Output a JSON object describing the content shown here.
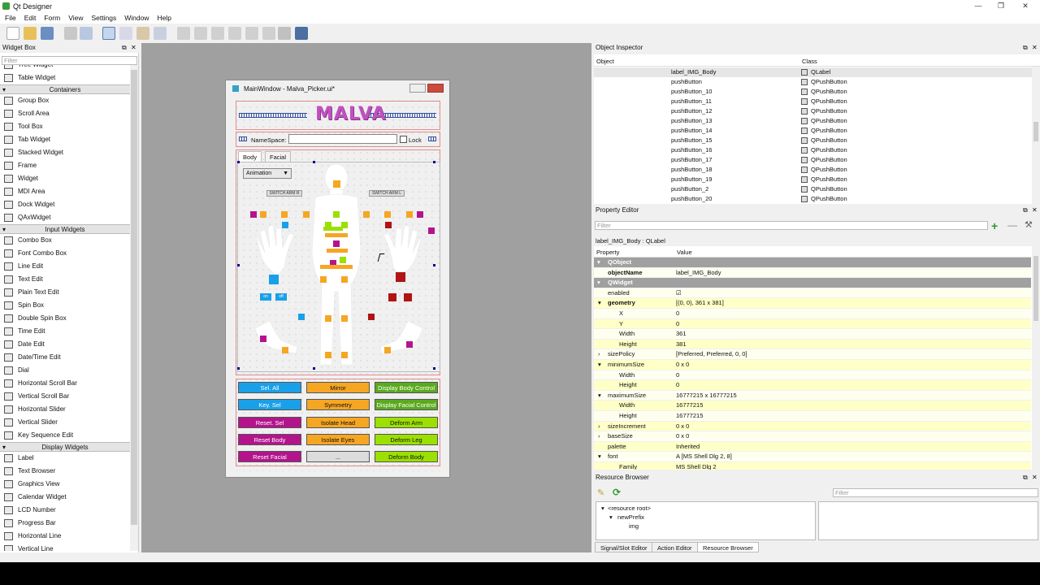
{
  "app": {
    "title": "Qt Designer"
  },
  "menu": [
    "File",
    "Edit",
    "Form",
    "View",
    "Settings",
    "Window",
    "Help"
  ],
  "widget_box": {
    "title": "Widget Box",
    "filter_placeholder": "Filter",
    "items": [
      {
        "t": "item",
        "label": "Tree Widget"
      },
      {
        "t": "item",
        "label": "Table Widget"
      },
      {
        "t": "cat",
        "label": "Containers"
      },
      {
        "t": "item",
        "label": "Group Box"
      },
      {
        "t": "item",
        "label": "Scroll Area"
      },
      {
        "t": "item",
        "label": "Tool Box"
      },
      {
        "t": "item",
        "label": "Tab Widget"
      },
      {
        "t": "item",
        "label": "Stacked Widget"
      },
      {
        "t": "item",
        "label": "Frame"
      },
      {
        "t": "item",
        "label": "Widget"
      },
      {
        "t": "item",
        "label": "MDI Area"
      },
      {
        "t": "item",
        "label": "Dock Widget"
      },
      {
        "t": "item",
        "label": "QAxWidget"
      },
      {
        "t": "cat",
        "label": "Input Widgets"
      },
      {
        "t": "item",
        "label": "Combo Box"
      },
      {
        "t": "item",
        "label": "Font Combo Box"
      },
      {
        "t": "item",
        "label": "Line Edit"
      },
      {
        "t": "item",
        "label": "Text Edit"
      },
      {
        "t": "item",
        "label": "Plain Text Edit"
      },
      {
        "t": "item",
        "label": "Spin Box"
      },
      {
        "t": "item",
        "label": "Double Spin Box"
      },
      {
        "t": "item",
        "label": "Time Edit"
      },
      {
        "t": "item",
        "label": "Date Edit"
      },
      {
        "t": "item",
        "label": "Date/Time Edit"
      },
      {
        "t": "item",
        "label": "Dial"
      },
      {
        "t": "item",
        "label": "Horizontal Scroll Bar"
      },
      {
        "t": "item",
        "label": "Vertical Scroll Bar"
      },
      {
        "t": "item",
        "label": "Horizontal Slider"
      },
      {
        "t": "item",
        "label": "Vertical Slider"
      },
      {
        "t": "item",
        "label": "Key Sequence Edit"
      },
      {
        "t": "cat",
        "label": "Display Widgets"
      },
      {
        "t": "item",
        "label": "Label"
      },
      {
        "t": "item",
        "label": "Text Browser"
      },
      {
        "t": "item",
        "label": "Graphics View"
      },
      {
        "t": "item",
        "label": "Calendar Widget"
      },
      {
        "t": "item",
        "label": "LCD Number"
      },
      {
        "t": "item",
        "label": "Progress Bar"
      },
      {
        "t": "item",
        "label": "Horizontal Line"
      },
      {
        "t": "item",
        "label": "Vertical Line"
      }
    ]
  },
  "form": {
    "title": "MainWindow - Malva_Picker.ui*",
    "logo": "MALVA",
    "namespace_label": "NameSpace:",
    "lock_label": "Lock",
    "tabs": [
      "Body",
      "Facial"
    ],
    "combo_value": "Animation",
    "switch_r": "SWITCH ARM R",
    "switch_l": "SWITCH ARM L",
    "small_btn_1": "on",
    "small_btn_2": "off",
    "grid": [
      [
        {
          "label": "Sel. All",
          "color": "#1aa0e8"
        },
        {
          "label": "Mirror",
          "color": "#f5a623"
        },
        {
          "label": "Display Body Control",
          "color": "#5aaa1e"
        }
      ],
      [
        {
          "label": "Key. Sel",
          "color": "#1aa0e8"
        },
        {
          "label": "Symmetry",
          "color": "#f5a623"
        },
        {
          "label": "Display Facial Control",
          "color": "#5aaa1e"
        }
      ],
      [
        {
          "label": "Reset. Sel",
          "color": "#b3148c"
        },
        {
          "label": "Isolate Head",
          "color": "#f5a623"
        },
        {
          "label": "Deform Arm",
          "color": "#9be000"
        }
      ],
      [
        {
          "label": "Reset Body",
          "color": "#b3148c"
        },
        {
          "label": "Isolate Eyes",
          "color": "#f5a623"
        },
        {
          "label": "Deform Leg",
          "color": "#9be000"
        }
      ],
      [
        {
          "label": "Reset Facial",
          "color": "#b3148c"
        },
        {
          "label": "...",
          "color": "#dcdcdc"
        },
        {
          "label": "Deform Body",
          "color": "#9be000"
        }
      ]
    ]
  },
  "object_inspector": {
    "title": "Object Inspector",
    "col_object": "Object",
    "col_class": "Class",
    "rows": [
      {
        "name": "label_IMG_Body",
        "cls": "QLabel"
      },
      {
        "name": "pushButton",
        "cls": "QPushButton"
      },
      {
        "name": "pushButton_10",
        "cls": "QPushButton"
      },
      {
        "name": "pushButton_11",
        "cls": "QPushButton"
      },
      {
        "name": "pushButton_12",
        "cls": "QPushButton"
      },
      {
        "name": "pushButton_13",
        "cls": "QPushButton"
      },
      {
        "name": "pushButton_14",
        "cls": "QPushButton"
      },
      {
        "name": "pushButton_15",
        "cls": "QPushButton"
      },
      {
        "name": "pushButton_16",
        "cls": "QPushButton"
      },
      {
        "name": "pushButton_17",
        "cls": "QPushButton"
      },
      {
        "name": "pushButton_18",
        "cls": "QPushButton"
      },
      {
        "name": "pushButton_19",
        "cls": "QPushButton"
      },
      {
        "name": "pushButton_2",
        "cls": "QPushButton"
      },
      {
        "name": "pushButton_20",
        "cls": "QPushButton"
      }
    ]
  },
  "property_editor": {
    "title": "Property Editor",
    "filter_placeholder": "Filter",
    "context": "label_IMG_Body : QLabel",
    "col_property": "Property",
    "col_value": "Value",
    "rows": [
      {
        "k": "QObject",
        "v": "",
        "t": "sec"
      },
      {
        "k": "objectName",
        "v": "label_IMG_Body",
        "t": "bold"
      },
      {
        "k": "QWidget",
        "v": "",
        "t": "sec"
      },
      {
        "k": "enabled",
        "v": "☑",
        "t": "n"
      },
      {
        "k": "geometry",
        "v": "[(0, 0), 361 x 381]",
        "t": "boldexp"
      },
      {
        "k": "X",
        "v": "0",
        "t": "sub"
      },
      {
        "k": "Y",
        "v": "0",
        "t": "sub"
      },
      {
        "k": "Width",
        "v": "361",
        "t": "sub"
      },
      {
        "k": "Height",
        "v": "381",
        "t": "sub"
      },
      {
        "k": "sizePolicy",
        "v": "[Preferred, Preferred, 0, 0]",
        "t": "col"
      },
      {
        "k": "minimumSize",
        "v": "0 x 0",
        "t": "exp"
      },
      {
        "k": "Width",
        "v": "0",
        "t": "sub"
      },
      {
        "k": "Height",
        "v": "0",
        "t": "sub"
      },
      {
        "k": "maximumSize",
        "v": "16777215 x 16777215",
        "t": "exp"
      },
      {
        "k": "Width",
        "v": "16777215",
        "t": "sub"
      },
      {
        "k": "Height",
        "v": "16777215",
        "t": "sub"
      },
      {
        "k": "sizeIncrement",
        "v": "0 x 0",
        "t": "col"
      },
      {
        "k": "baseSize",
        "v": "0 x 0",
        "t": "col"
      },
      {
        "k": "palette",
        "v": "Inherited",
        "t": "n"
      },
      {
        "k": "font",
        "v": "A  [MS Shell Dlg 2, 8]",
        "t": "exp"
      },
      {
        "k": "Family",
        "v": "MS Shell Dlg 2",
        "t": "sub"
      }
    ]
  },
  "resource_browser": {
    "title": "Resource Browser",
    "filter_placeholder": "Filter",
    "tree": [
      "<resource root>",
      "newPrefix",
      "img"
    ]
  },
  "bottom_tabs": [
    "Signal/Slot Editor",
    "Action Editor",
    "Resource Browser"
  ],
  "colors": {
    "blue": "#1aa0e8",
    "orange": "#f5a623",
    "magenta": "#b3148c",
    "green": "#9be000",
    "red": "#b01414",
    "prop_yellow": "#ffffc8",
    "prop_section": "#a0a0a0"
  }
}
